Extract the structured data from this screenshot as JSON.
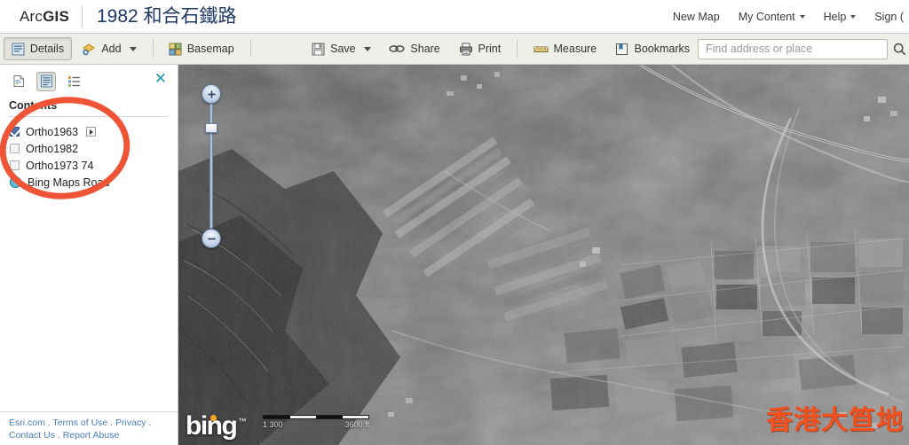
{
  "header": {
    "brand_prefix": "Arc",
    "brand_suffix": "GIS",
    "map_title": "1982 和合石鐵路",
    "nav": [
      {
        "label": "New Map",
        "caret": false
      },
      {
        "label": "My Content",
        "caret": true
      },
      {
        "label": "Help",
        "caret": true
      },
      {
        "label": "Sign (",
        "caret": false
      }
    ]
  },
  "toolbar": {
    "details_label": "Details",
    "add_label": "Add",
    "basemap_label": "Basemap",
    "save_label": "Save",
    "share_label": "Share",
    "print_label": "Print",
    "measure_label": "Measure",
    "bookmarks_label": "Bookmarks",
    "search_placeholder": "Find address or place",
    "search_value": ""
  },
  "panel": {
    "tabs": [
      {
        "name": "about-tab",
        "title": "About"
      },
      {
        "name": "contents-tab",
        "title": "Contents",
        "active": true
      },
      {
        "name": "legend-tab",
        "title": "Legend"
      }
    ],
    "close_label": "✕",
    "contents_title": "Contents",
    "layers": [
      {
        "label": "Ortho1963",
        "checked": true,
        "type": "checkbox",
        "expandable": true
      },
      {
        "label": "Ortho1982",
        "checked": false,
        "type": "checkbox",
        "expandable": false
      },
      {
        "label": "Ortho1973 74",
        "checked": false,
        "type": "checkbox",
        "expandable": false
      },
      {
        "label": "Bing Maps Road",
        "checked": true,
        "type": "globe",
        "expandable": false
      }
    ],
    "footer": {
      "line1": [
        "Esri.com",
        "Terms of Use",
        "Privacy"
      ],
      "line2": [
        "Contact Us",
        "Report Abuse"
      ],
      "separator": " . "
    }
  },
  "map": {
    "basemap_credit": "bing",
    "basemap_tm": "™",
    "scale_labels": [
      "1 300",
      "3600 ft"
    ],
    "watermark": "香港大笪地",
    "zoom_in_label": "+",
    "zoom_out_label": "−"
  },
  "colors": {
    "title": "#1f3864",
    "link": "#4a7ebb",
    "toolbar_bg": "#efefe9",
    "annotation": "#ef5436",
    "watermark": "#f4501e",
    "close": "#1b9aaa"
  }
}
